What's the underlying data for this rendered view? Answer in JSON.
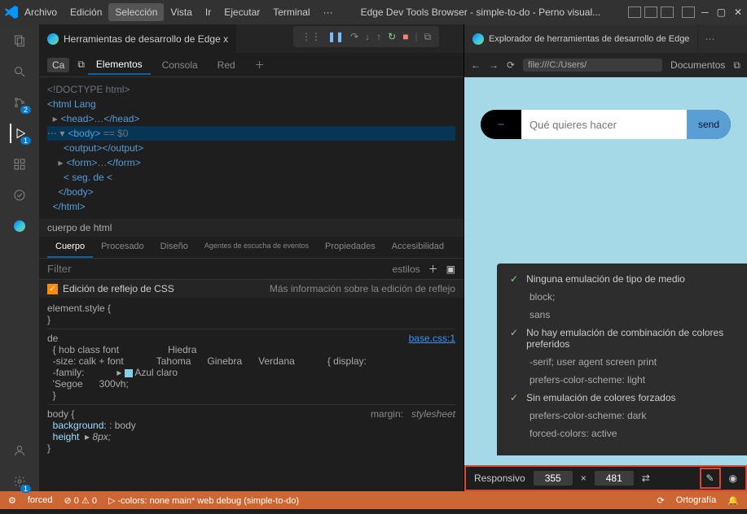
{
  "menu": {
    "archivo": "Archivo",
    "edicion": "Edición",
    "seleccion": "Selección",
    "vista": "Vista",
    "ir": "Ir",
    "ejecutar": "Ejecutar",
    "terminal": "Terminal",
    "dots": "···"
  },
  "title": "Edge Dev Tools Browser - simple-to-do - Perno visual...",
  "tabs": {
    "left": "Herramientas de desarrollo de Edge x",
    "right": "Explorador de herramientas de desarrollo de Edge"
  },
  "subtabs": {
    "ca": "Ca",
    "elementos": "Elementos",
    "consola": "Consola",
    "red": "Red"
  },
  "dom": {
    "l1": "<!DOCTYPE html>",
    "l2": "<html Lang",
    "l3_open": "<head>",
    "l3_mid": "…",
    "l3_close": "</head>",
    "l4": "<body>",
    "l4_eq": " == $0",
    "l5": "<output></output>",
    "l6_open": "<form>",
    "l6_mid": "…",
    "l6_close": "</form>",
    "l7": "< seg. de <",
    "l8": "</body>",
    "l9": "</html>"
  },
  "crumb": "cuerpo de html",
  "panels": {
    "cuerpo": "Cuerpo",
    "procesado": "Procesado",
    "diseno": "Diseño",
    "agentes": "Agentes de escucha de eventos",
    "propiedades": "Propiedades",
    "accesibilidad": "Accesibilidad"
  },
  "filter": {
    "placeholder": "Filter",
    "estilos": "estilos"
  },
  "mirror": {
    "label": "Edición de reflejo de CSS",
    "more": "Más información sobre la edición de reflejo"
  },
  "styles": {
    "elstyle": "element.style {",
    "close": "}",
    "de": "de",
    "basecss": "base.css:1",
    "hob": "{ hob class font",
    "hiedra": "Hiedra",
    "size": "-size: calk + font",
    "tahoma": "Tahoma",
    "ginebra": "Ginebra",
    "verdana": "Verdana",
    "display": "{ display:",
    "family": "-family:",
    "azul": "Azul claro",
    "segoe": "'Segoe",
    "vh": "300vh;",
    "body": "body {",
    "margin": "margin:",
    "sheet": "stylesheet",
    "bg": "background:",
    "bval": ": body",
    "h": "height",
    "hval": "8px;"
  },
  "url": {
    "path": "file:///C:/Users/",
    "docs": "Documentos"
  },
  "todo": {
    "placeholder": "Qué quieres hacer",
    "send": "send"
  },
  "emul": {
    "r1": "Ninguna emulación de tipo de medio",
    "r1a": "block;",
    "r1b": "sans",
    "r2": "No hay emulación de combinación de colores preferidos",
    "r2a": "-serif; user agent screen print",
    "r2b": "prefers-color-scheme: light",
    "r3": "Sin emulación de colores forzados",
    "r3a": "prefers-color-scheme: dark",
    "r3b": "forced-colors: active"
  },
  "resp": {
    "label": "Responsivo",
    "w": "355",
    "x": "×",
    "h": "481"
  },
  "status": {
    "forced": "forced",
    "colors": "-colors: none main* web debug (simple-to-do)",
    "orto": "Ortografía",
    "zero": "0"
  },
  "badges": {
    "b1": "2",
    "b2": "1",
    "b3": "1"
  }
}
